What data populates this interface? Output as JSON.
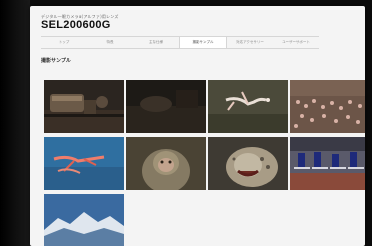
{
  "header": {
    "subtitle": "デジタル一眼カメラα(アルファ)用レンズ",
    "title": "SEL200600G"
  },
  "nav": {
    "tabs": [
      {
        "label": "トップ"
      },
      {
        "label": "特長"
      },
      {
        "label": "主な仕様"
      },
      {
        "label": "撮影サンプル",
        "active": true
      },
      {
        "label": "対応アクセサリー"
      },
      {
        "label": "ユーザーサポート"
      }
    ]
  },
  "section": {
    "title": "撮影サンプル"
  },
  "gallery": {
    "photos": [
      {
        "icon": "train-photo"
      },
      {
        "icon": "dark-photo"
      },
      {
        "icon": "flamingo-flying-photo"
      },
      {
        "icon": "flamingo-flock-photo"
      },
      {
        "icon": "flamingo-blue-sky-photo"
      },
      {
        "icon": "monkey-photo"
      },
      {
        "icon": "snow-leopard-photo"
      },
      {
        "icon": "hurdles-race-photo"
      },
      {
        "icon": "snow-mountain-photo"
      }
    ]
  }
}
